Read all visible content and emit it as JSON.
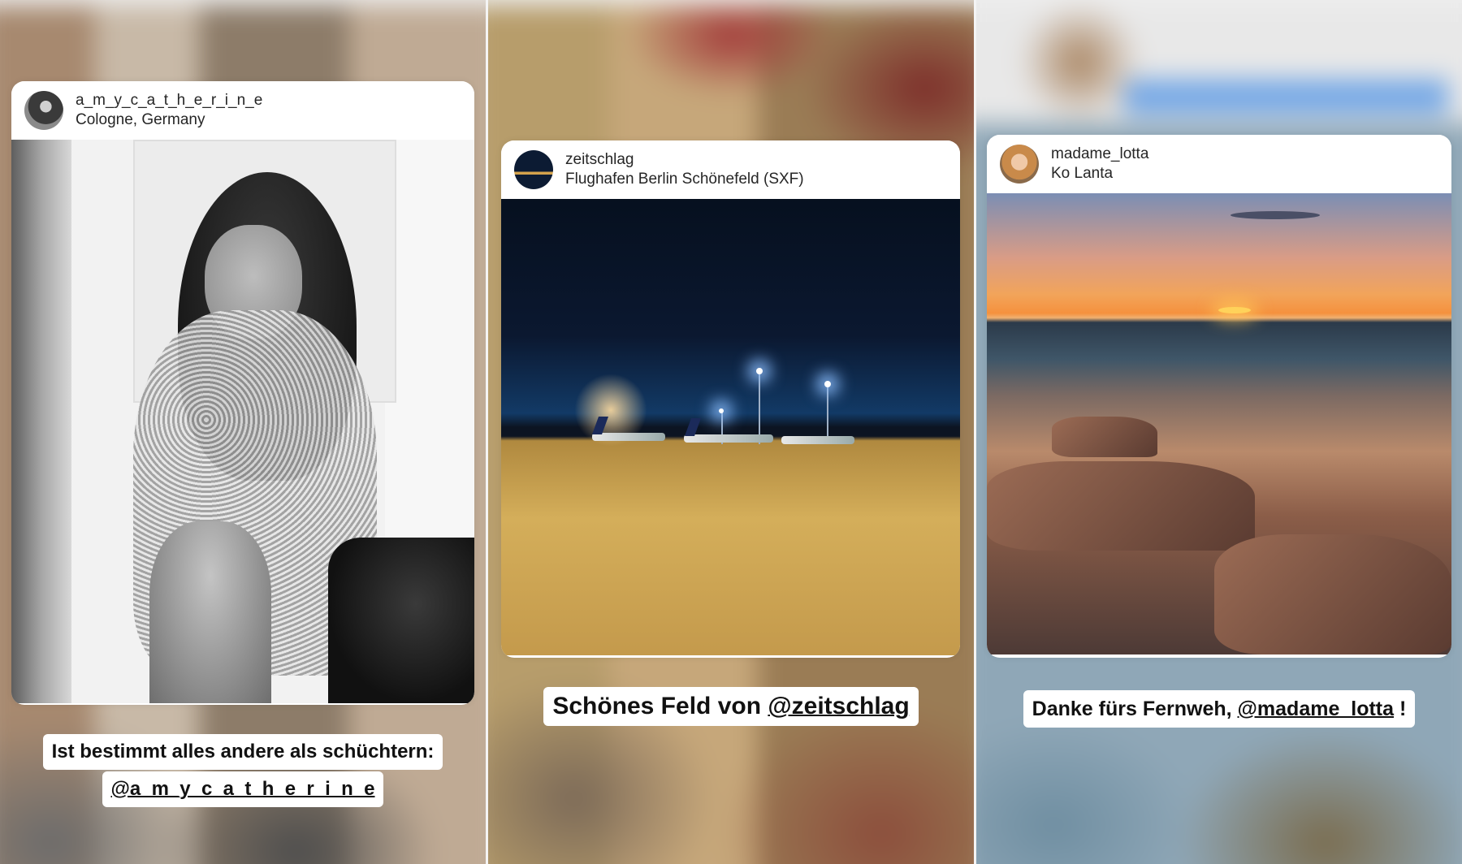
{
  "posts": [
    {
      "username": "a_m_y_c_a_t_h_e_r_i_n_e",
      "location": "Cologne, Germany",
      "caption_line1": "Ist bestimmt alles andere als schüchtern:",
      "caption_mention": "@a_m_y_c_a_t_h_e_r_i_n_e",
      "avatar_icon": "profile-photo-icon"
    },
    {
      "username": "zeitschlag",
      "location": "Flughafen Berlin Schönefeld (SXF)",
      "caption_prefix": "Schönes Feld von ",
      "caption_mention": "@zeitschlag",
      "avatar_icon": "profile-photo-icon"
    },
    {
      "username": "madame_lotta",
      "location": "Ko Lanta",
      "caption_prefix": "Danke fürs Fernweh, ",
      "caption_mention": "@madame_lotta",
      "caption_suffix": " !",
      "avatar_icon": "profile-photo-icon"
    }
  ],
  "colors": {
    "card_background": "#ffffff",
    "text": "#262626",
    "caption_text": "#111111"
  }
}
